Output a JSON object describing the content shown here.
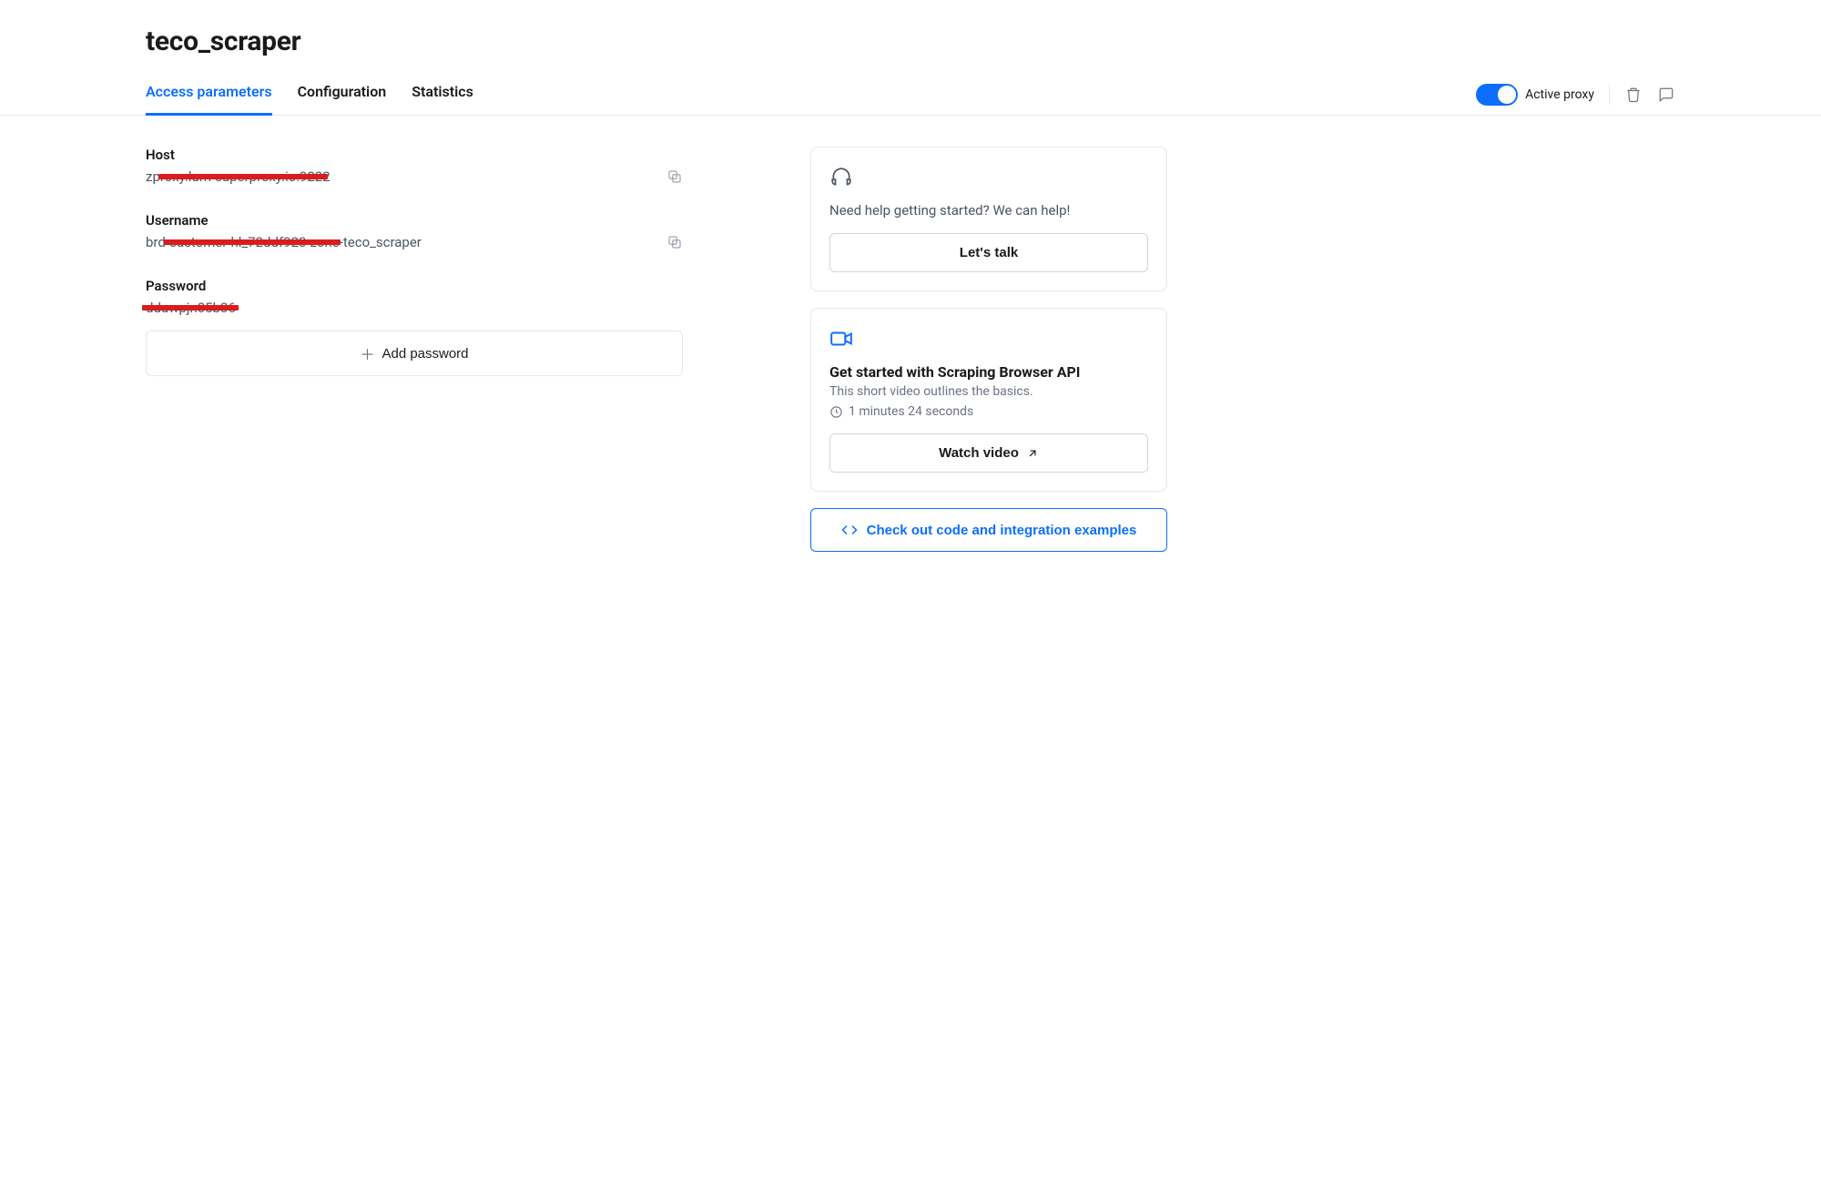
{
  "page_title": "teco_scraper",
  "tabs": {
    "access_parameters": "Access parameters",
    "configuration": "Configuration",
    "statistics": "Statistics"
  },
  "toggle_label": "Active proxy",
  "fields": {
    "host": {
      "label": "Host",
      "value": "zproxy.lum-superproxy.io:9222"
    },
    "username": {
      "label": "Username",
      "value": "brd-customer-hl_72ddf923-zone-teco_scraper"
    },
    "password": {
      "label": "Password",
      "value": "dduwpjn05b36"
    }
  },
  "add_password_label": "Add password",
  "help_card": {
    "text": "Need help getting started? We can help!",
    "button": "Let's talk"
  },
  "video_card": {
    "title": "Get started with Scraping Browser API",
    "sub": "This short video outlines the basics.",
    "duration": "1 minutes 24 seconds",
    "button": "Watch video"
  },
  "code_link": "Check out code and integration examples"
}
